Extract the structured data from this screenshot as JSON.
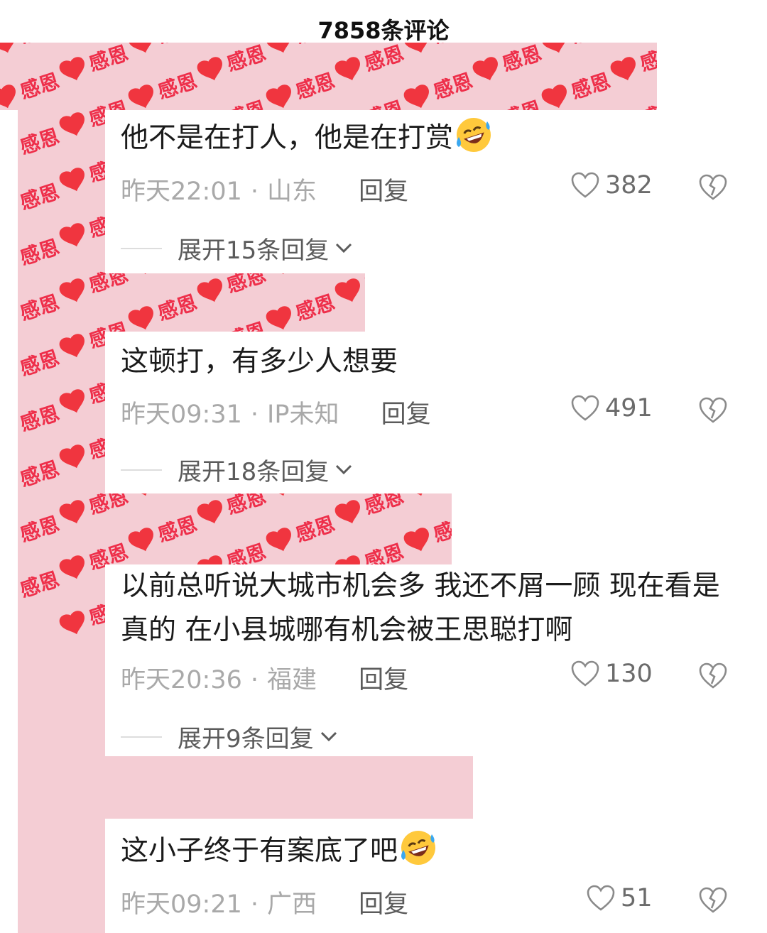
{
  "header": {
    "title": "7858条评论"
  },
  "sticker": {
    "label": "感恩"
  },
  "comments": [
    {
      "text": "他不是在打人，他是在打赏",
      "emoji": "grinning-squinting-tears-emoji",
      "time": "昨天22:01",
      "location": "山东",
      "reply_label": "回复",
      "likes": "382",
      "expand_label": "展开15条回复"
    },
    {
      "text": "这顿打，有多少人想要",
      "emoji": "",
      "time": "昨天09:31",
      "location": "IP未知",
      "reply_label": "回复",
      "likes": "491",
      "expand_label": "展开18条回复"
    },
    {
      "text": "以前总听说大城市机会多 我还不屑一顾 现在看是真的 在小县城哪有机会被王思聪打啊",
      "emoji": "",
      "time": "昨天20:36",
      "location": "福建",
      "reply_label": "回复",
      "likes": "130",
      "expand_label": "展开9条回复"
    },
    {
      "text": "这小子终于有案底了吧",
      "emoji": "grinning-squinting-tears-emoji",
      "time": "昨天09:21",
      "location": "广西",
      "reply_label": "回复",
      "likes": "51",
      "expand_label": ""
    }
  ],
  "icons": {
    "like": "heart-outline-icon",
    "dislike": "broken-heart-icon",
    "expand": "chevron-down-icon"
  },
  "colors": {
    "sticker_background": "#f4cdd4",
    "sticker_heart": "#f0353f",
    "sticker_text": "#ee2f4a",
    "meta_text": "#a9a9a9",
    "comment_text": "#1b1b1b"
  }
}
